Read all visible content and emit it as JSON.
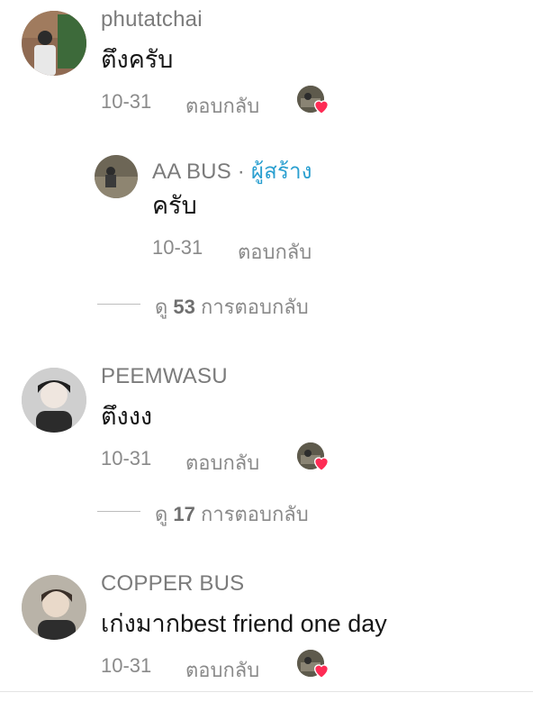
{
  "comments": [
    {
      "username": "phutatchai",
      "text": "ตึงครับ",
      "date": "10-31",
      "reply_label": "ตอบกลับ",
      "creator_liked": true,
      "reply": {
        "username": "AA BUS",
        "creator_separator": "·",
        "creator_tag": "ผู้สร้าง",
        "text": "ครับ",
        "date": "10-31",
        "reply_label": "ตอบกลับ"
      },
      "view_replies": {
        "prefix": "ดู",
        "count": "53",
        "suffix": "การตอบกลับ"
      }
    },
    {
      "username": "PEEMWASU",
      "text": "ตึงงง",
      "date": "10-31",
      "reply_label": "ตอบกลับ",
      "creator_liked": true,
      "view_replies": {
        "prefix": "ดู",
        "count": "17",
        "suffix": "การตอบกลับ"
      }
    },
    {
      "username": "COPPER BUS",
      "text": "เก่งมากbest friend one day",
      "date": "10-31",
      "reply_label": "ตอบกลับ",
      "creator_liked": true
    }
  ],
  "colors": {
    "creator_tag": "#2a9fd0",
    "heart": "#fe2c55",
    "meta_text": "#8a8a8a"
  }
}
